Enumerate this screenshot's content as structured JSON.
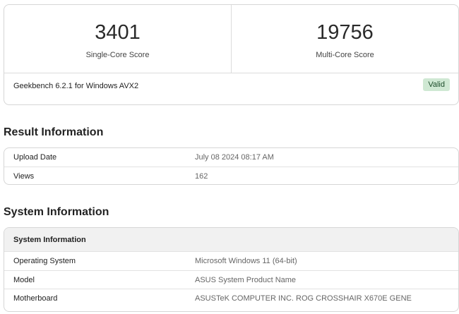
{
  "scores": {
    "single_core": {
      "value": "3401",
      "label": "Single-Core Score"
    },
    "multi_core": {
      "value": "19756",
      "label": "Multi-Core Score"
    }
  },
  "version": "Geekbench 6.2.1 for Windows AVX2",
  "valid_badge": "Valid",
  "colors": {
    "badge_bg": "#cfe8d3",
    "badge_text": "#1d4d2b",
    "header_bg": "#f1f1f1"
  },
  "result_information": {
    "heading": "Result Information",
    "rows": [
      {
        "key": "Upload Date",
        "value": "July 08 2024 08:17 AM"
      },
      {
        "key": "Views",
        "value": "162"
      }
    ]
  },
  "system_information": {
    "heading": "System Information",
    "table_header": "System Information",
    "rows": [
      {
        "key": "Operating System",
        "value": "Microsoft Windows 11 (64-bit)"
      },
      {
        "key": "Model",
        "value": "ASUS System Product Name"
      },
      {
        "key": "Motherboard",
        "value": "ASUSTeK COMPUTER INC. ROG CROSSHAIR X670E GENE"
      }
    ]
  }
}
